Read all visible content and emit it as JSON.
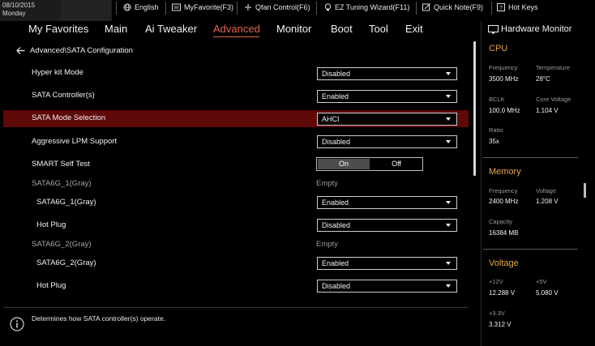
{
  "topbar": {
    "date": "08/10/2015",
    "day": "Monday",
    "tools": [
      {
        "label": "English",
        "icon": "globe-icon"
      },
      {
        "label": "MyFavorite(F3)",
        "icon": "favorite-icon"
      },
      {
        "label": "Qfan Control(F6)",
        "icon": "fan-icon"
      },
      {
        "label": "EZ Tuning Wizard(F11)",
        "icon": "bulb-icon"
      },
      {
        "label": "Quick Note(F9)",
        "icon": "note-icon"
      },
      {
        "label": "Hot Keys",
        "icon": "help-icon"
      }
    ]
  },
  "menu": {
    "items": [
      "My Favorites",
      "Main",
      "Ai Tweaker",
      "Advanced",
      "Monitor",
      "Boot",
      "Tool",
      "Exit"
    ],
    "active": "Advanced",
    "accent_color": "#e36552"
  },
  "breadcrumb": "Advanced\\SATA Configuration",
  "settings": {
    "hyper_kit_mode": {
      "label": "Hyper kit Mode",
      "value": "Disabled"
    },
    "sata_controller": {
      "label": "SATA Controller(s)",
      "value": "Enabled"
    },
    "sata_mode": {
      "label": "SATA Mode Selection",
      "value": "AHCI"
    },
    "aggressive_lpm": {
      "label": "Aggressive LPM Support",
      "value": "Disabled"
    },
    "smart_self_test": {
      "label": "SMART Self Test",
      "on": "On",
      "off": "Off",
      "selected": "On"
    },
    "port1_header": {
      "label": "SATA6G_1(Gray)",
      "value": "Empty"
    },
    "port1": {
      "label": "SATA6G_1(Gray)",
      "value": "Enabled"
    },
    "port1_hotplug": {
      "label": "Hot Plug",
      "value": "Disabled"
    },
    "port2_header": {
      "label": "SATA6G_2(Gray)",
      "value": "Empty"
    },
    "port2": {
      "label": "SATA6G_2(Gray)",
      "value": "Enabled"
    },
    "port2_hotplug": {
      "label": "Hot Plug",
      "value": "Disabled"
    },
    "highlight_color": "#5e0808"
  },
  "help": {
    "text": "Determines how SATA controller(s) operate."
  },
  "hardware_monitor": {
    "title": "Hardware Monitor",
    "section_color": "#e6a84a",
    "cpu": {
      "title": "CPU",
      "frequency_label": "Frequency",
      "frequency": "3500 MHz",
      "temperature_label": "Temperature",
      "temperature": "28°C",
      "bclk_label": "BCLK",
      "bclk": "100.0 MHz",
      "core_voltage_label": "Core Voltage",
      "core_voltage": "1.104 V",
      "ratio_label": "Ratio",
      "ratio": "35x"
    },
    "memory": {
      "title": "Memory",
      "frequency_label": "Frequency",
      "frequency": "2400 MHz",
      "voltage_label": "Voltage",
      "voltage": "1.208 V",
      "capacity_label": "Capacity",
      "capacity": "16384 MB"
    },
    "voltage": {
      "title": "Voltage",
      "v12_label": "+12V",
      "v12": "12.288 V",
      "v5_label": "+5V",
      "v5": "5.080 V",
      "v33_label": "+3.3V",
      "v33": "3.312 V"
    }
  }
}
